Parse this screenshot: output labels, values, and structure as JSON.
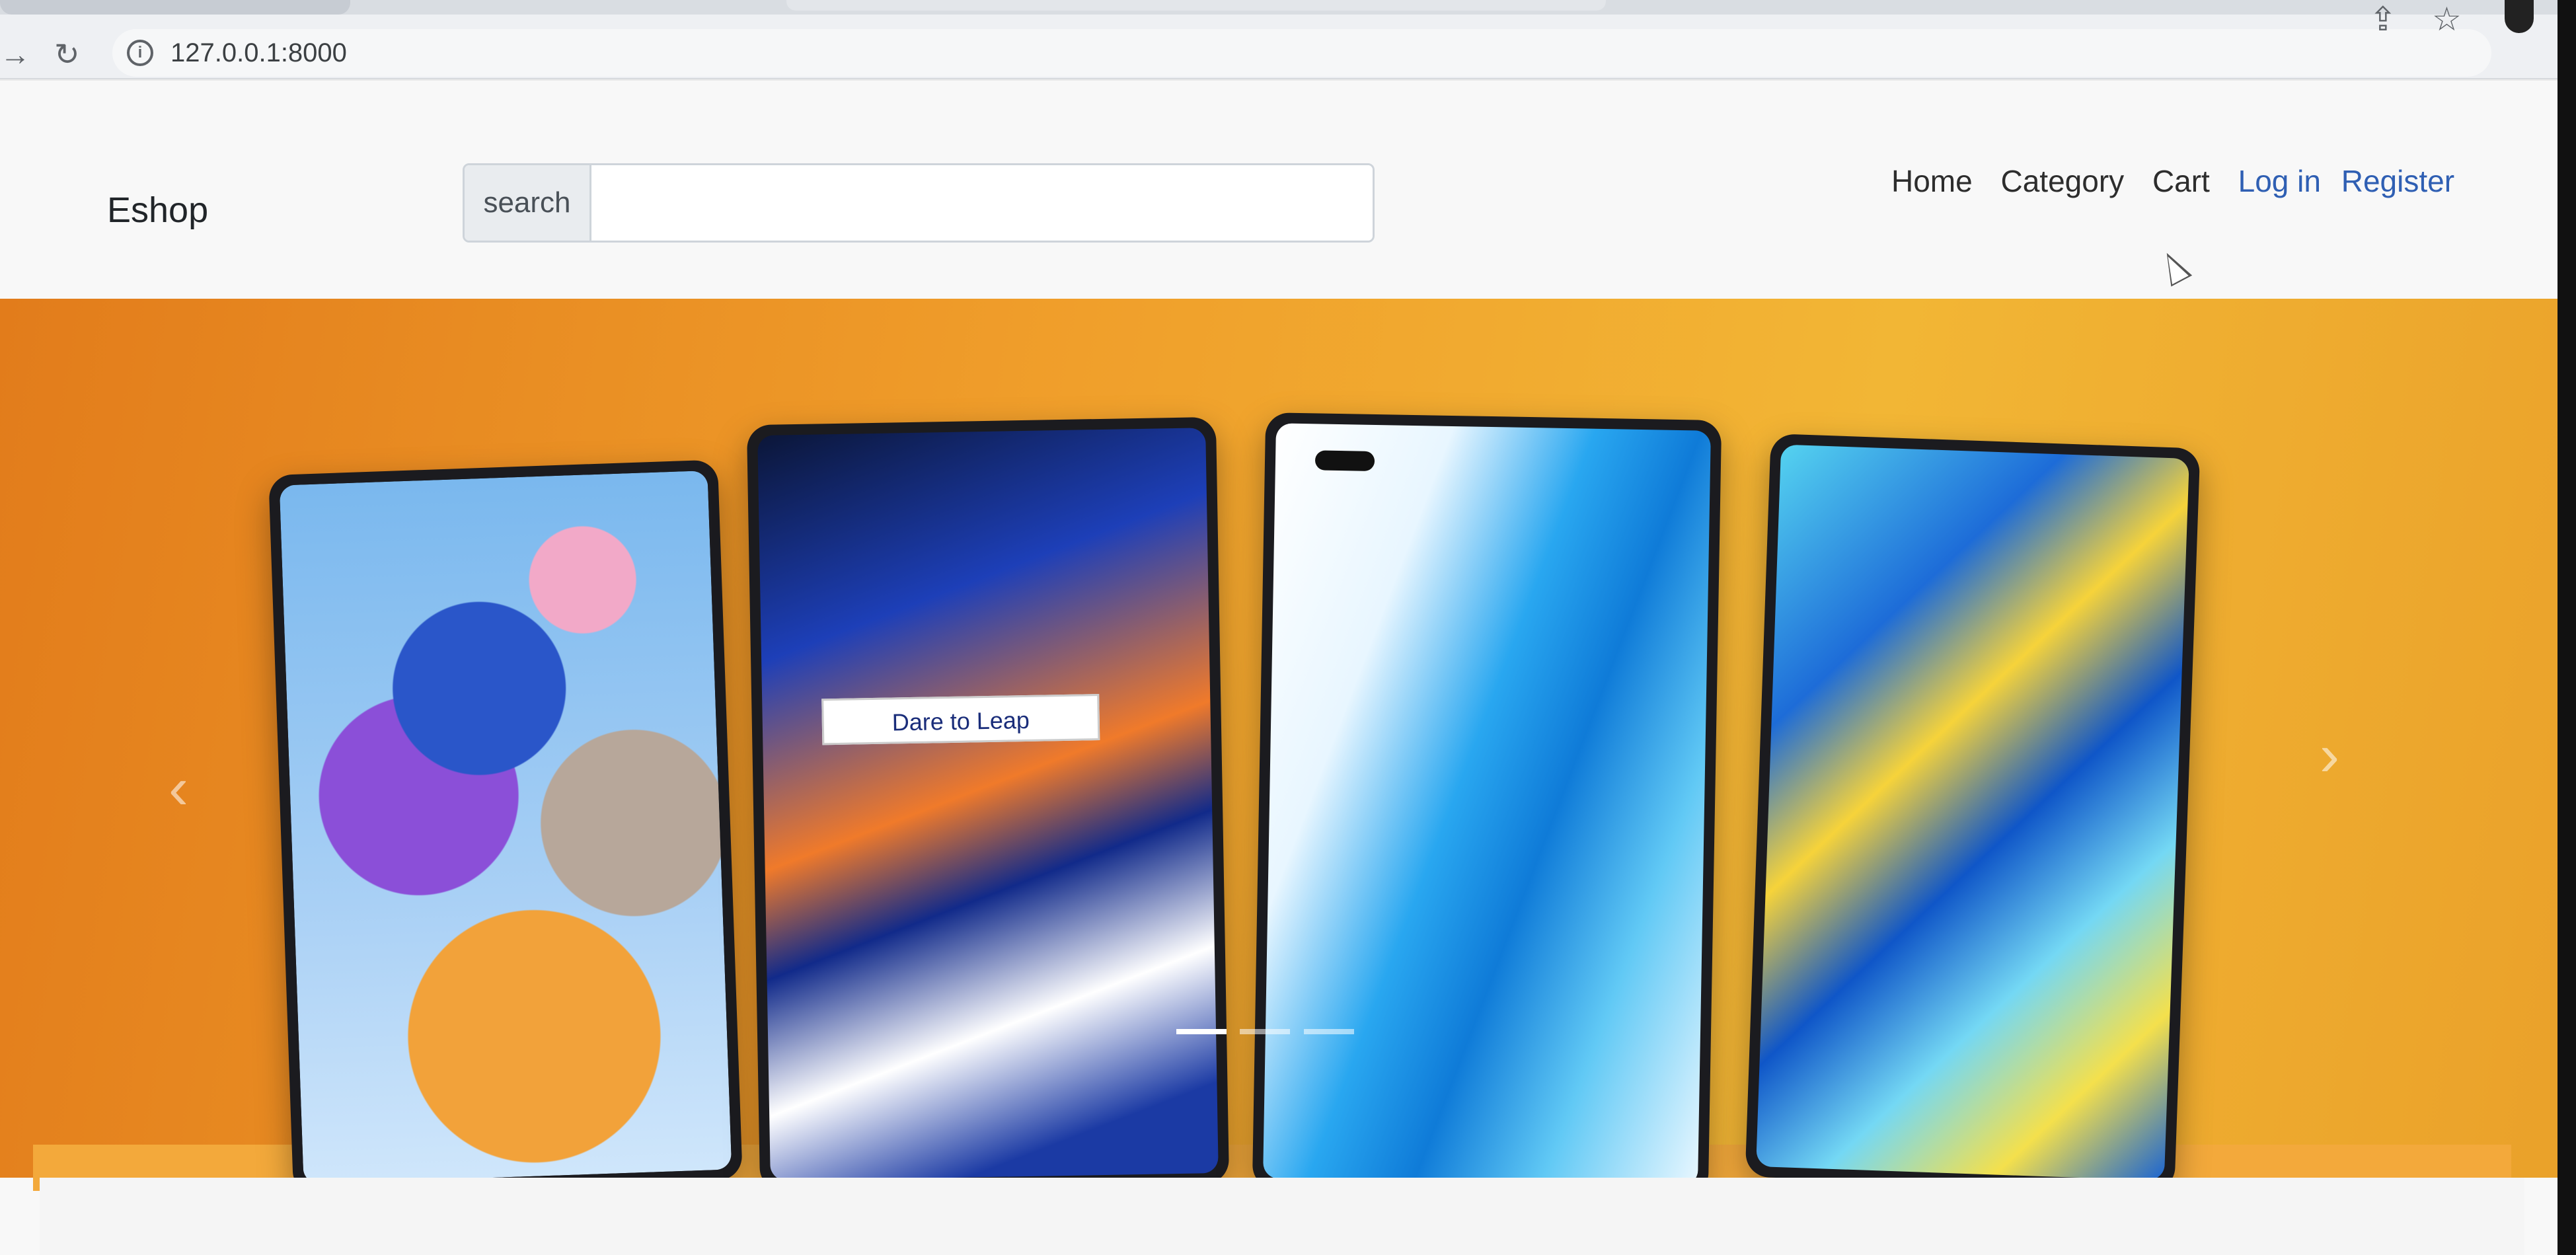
{
  "browser": {
    "url": "127.0.0.1:8000",
    "back_icon": "arrow-right-icon",
    "reload_icon": "reload-icon",
    "site_info_icon": "info-icon",
    "share_icon": "share-icon",
    "bookmark_icon": "star-icon"
  },
  "navbar": {
    "brand": "Eshop",
    "search_label": "search",
    "search_value": "",
    "links": {
      "home": "Home",
      "category": "Category",
      "cart": "Cart",
      "login": "Log in",
      "register": "Register"
    }
  },
  "carousel": {
    "tag_text": "Dare to Leap",
    "indicators_count": 3,
    "active_indicator": 1,
    "prev_glyph": "‹",
    "next_glyph": "›",
    "colors": {
      "background_start": "#e27c1b",
      "background_end": "#f2b635"
    }
  },
  "colors": {
    "link_blue": "#2f5fb3",
    "text_dark": "#212529"
  }
}
